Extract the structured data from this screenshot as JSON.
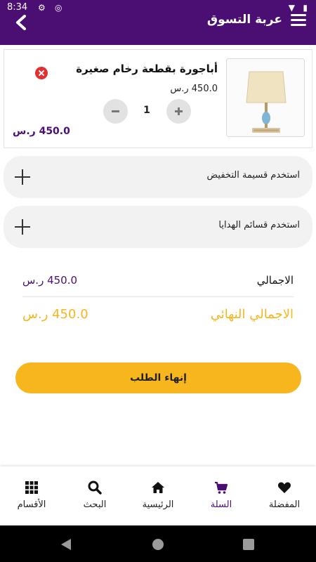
{
  "status_bar": {
    "time": "8:34"
  },
  "app_bar": {
    "title": "عربة التسوق",
    "back_icon": "chevron-left-icon",
    "menu_icon": "hamburger-menu-icon"
  },
  "cart_item": {
    "name": "أباجورة بقطعة رخام صغيرة",
    "unit_price": "450.0 ر.س",
    "quantity": "1",
    "line_total": "450.0 ر.س"
  },
  "coupons": {
    "discount_label": "استخدم قسيمة التخفيض",
    "gift_label": "استخدم قسائم الهدايا"
  },
  "totals": {
    "subtotal_label": "الاجمالي",
    "subtotal_value": "450.0 ر.س",
    "final_label": "الاجمالي النهائي",
    "final_value": "450.0 ر.س"
  },
  "checkout": {
    "label": "إنهاء الطلب"
  },
  "bottom_nav": {
    "favorites": "المفضلة",
    "cart": "السلة",
    "home": "الرئيسية",
    "search": "البحث",
    "categories": "الأقسام"
  },
  "colors": {
    "brand": "#4b0f74",
    "accent": "#f7b51e",
    "danger": "#e03030"
  }
}
